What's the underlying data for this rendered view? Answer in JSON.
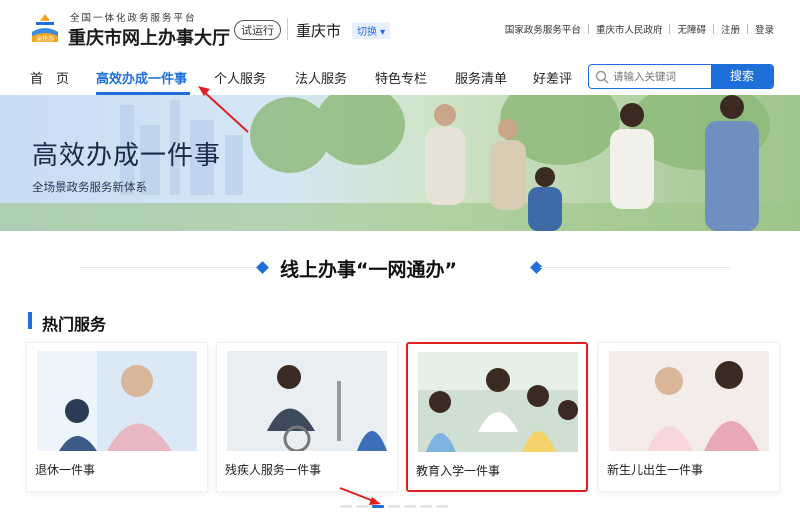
{
  "header": {
    "brand_small": "全国一体化政务服务平台",
    "brand_big": "重庆市网上办事大厅",
    "trial_badge": "试运行",
    "city": "重庆市",
    "switch_label": "切换 ▾",
    "top_links": [
      "国家政务服务平台",
      "重庆市人民政府",
      "无障碍",
      "注册",
      "登录"
    ],
    "logo_text": "渝快办"
  },
  "nav": {
    "items": [
      "首　页",
      "高效办成一件事",
      "个人服务",
      "法人服务",
      "特色专栏",
      "服务清单",
      "好差评"
    ],
    "active_index": 1
  },
  "search": {
    "placeholder": "请输入关键词",
    "button_label": "搜索"
  },
  "banner": {
    "title": "高效办成一件事",
    "subtitle": "全场景政务服务新体系"
  },
  "section": {
    "title": "线上办事“一网通办”",
    "hot_title": "热门服务"
  },
  "cards": [
    {
      "label": "退休一件事"
    },
    {
      "label": "残疾人服务一件事"
    },
    {
      "label": "教育入学一件事"
    },
    {
      "label": "新生儿出生一件事"
    }
  ],
  "carousel": {
    "total": 7,
    "active": 3
  },
  "colors": {
    "accent": "#1e6fd9",
    "highlight": "#e02020"
  }
}
